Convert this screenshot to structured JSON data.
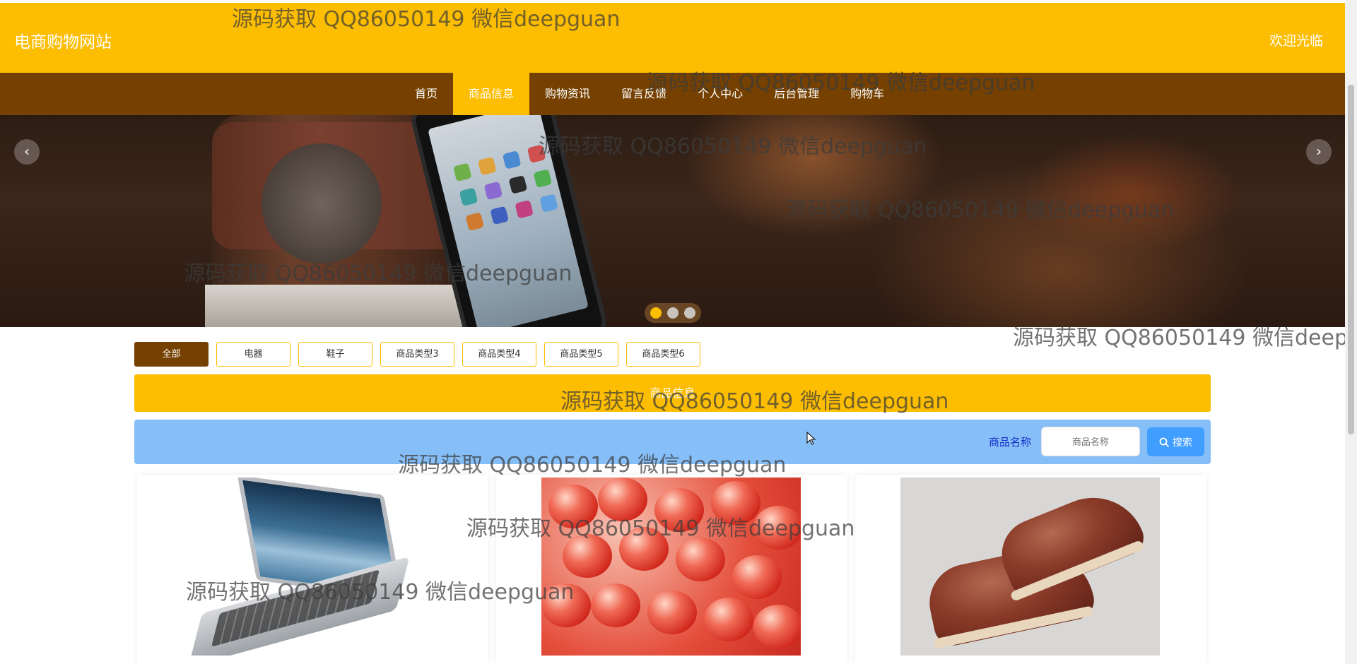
{
  "header": {
    "site_title": "电商购物网站",
    "welcome": "欢迎光临"
  },
  "nav": {
    "items": [
      {
        "label": "首页",
        "active": false
      },
      {
        "label": "商品信息",
        "active": true
      },
      {
        "label": "购物资讯",
        "active": false
      },
      {
        "label": "留言反馈",
        "active": false
      },
      {
        "label": "个人中心",
        "active": false
      },
      {
        "label": "后台管理",
        "active": false
      },
      {
        "label": "购物车",
        "active": false
      }
    ]
  },
  "banner": {
    "prev_icon": "chevron-left-icon",
    "next_icon": "chevron-right-icon",
    "slide_count": 3,
    "active_slide": 1
  },
  "filters": {
    "items": [
      "全部",
      "电器",
      "鞋子",
      "商品类型3",
      "商品类型4",
      "商品类型5",
      "商品类型6"
    ],
    "active": "全部"
  },
  "section": {
    "title": "商品信息"
  },
  "search": {
    "label": "商品名称",
    "placeholder": "商品名称",
    "button_label": "搜索",
    "button_icon": "search-icon"
  },
  "products": [
    {
      "image": "laptop"
    },
    {
      "image": "cherries"
    },
    {
      "image": "leather-shoes"
    }
  ],
  "watermark": {
    "text": "源码获取 QQ86050149 微信deepguan"
  },
  "colors": {
    "header": "#fdbd00",
    "nav": "#754000",
    "search_bar": "#86bef8",
    "search_button": "#409eff"
  }
}
